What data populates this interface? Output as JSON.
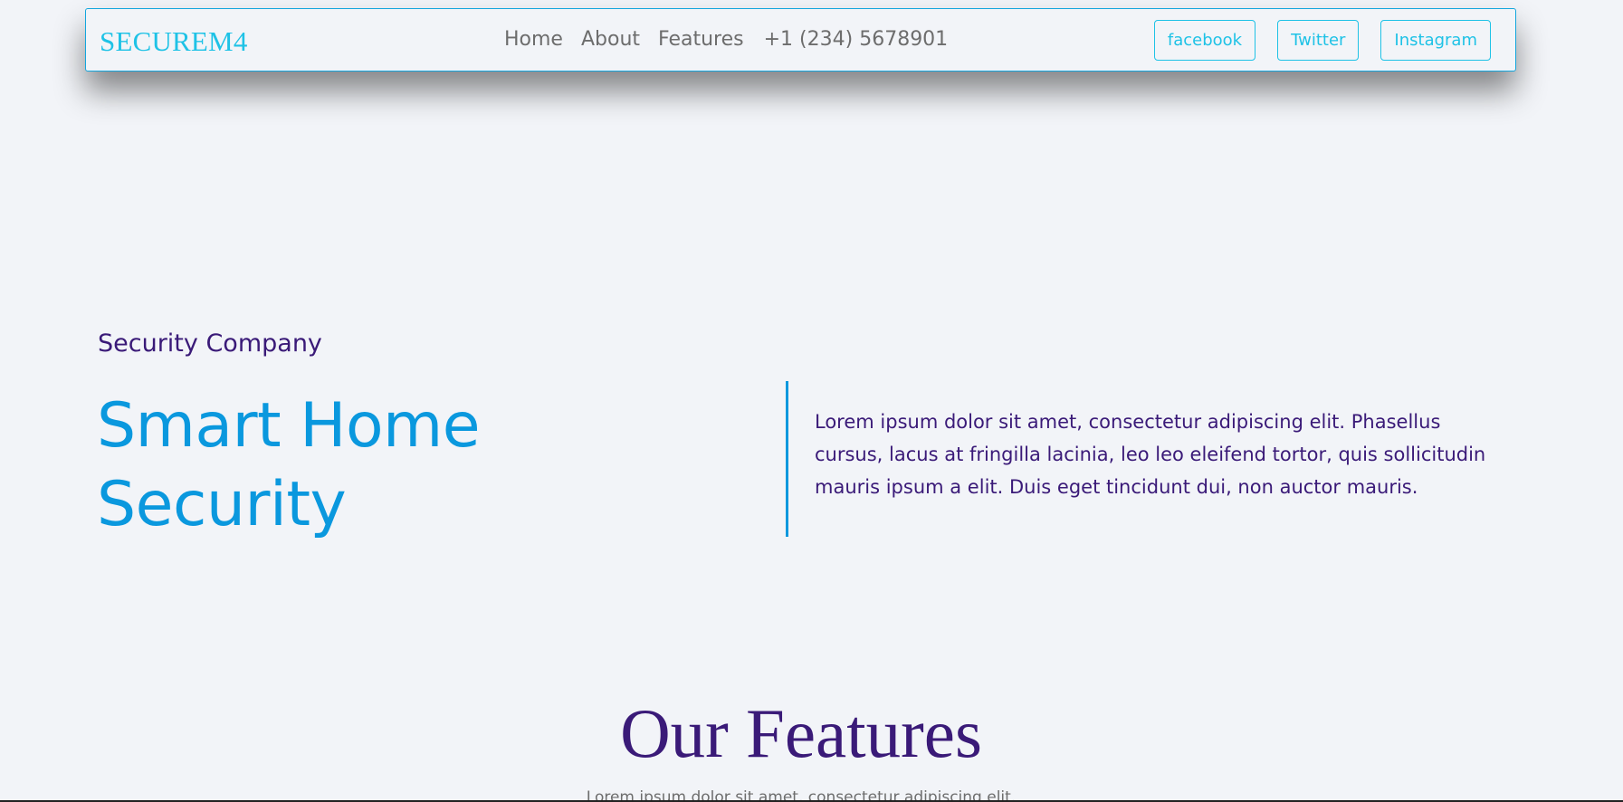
{
  "navbar": {
    "brand": "SECUREM4",
    "links": [
      {
        "label": "Home"
      },
      {
        "label": "About"
      },
      {
        "label": "Features"
      },
      {
        "label": "+1 (234) 5678901"
      }
    ],
    "social": [
      {
        "label": "facebook"
      },
      {
        "label": "Twitter"
      },
      {
        "label": "Instagram"
      }
    ]
  },
  "hero": {
    "eyebrow": "Security Company",
    "title": "Smart Home Security",
    "description": "Lorem ipsum dolor sit amet, consectetur adipiscing elit. Phasellus cursus, lacus at fringilla lacinia, leo leo eleifend tortor, quis sollicitudin mauris ipsum a elit. Duis eget tincidunt dui, non auctor mauris."
  },
  "features": {
    "title": "Our Features",
    "subtitle": "Lorem ipsum dolor sit amet, consectetur adipiscing elit."
  },
  "colors": {
    "accent": "#1ec2e6",
    "primary": "#0a98de",
    "text_purple": "#3a1a78",
    "background": "#f2f4f8"
  }
}
